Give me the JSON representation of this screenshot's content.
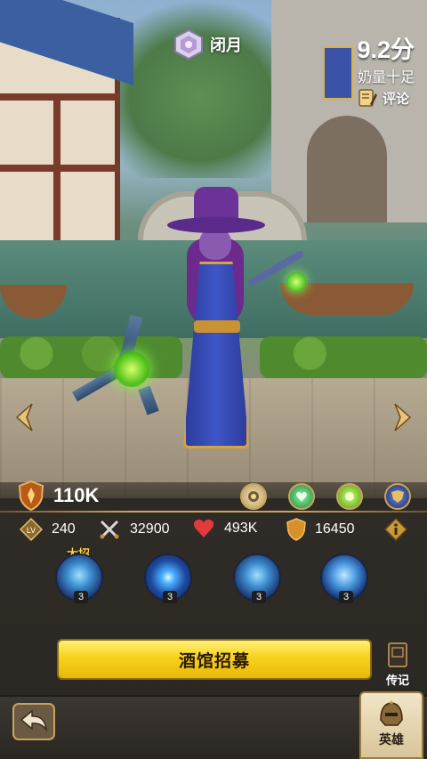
{
  "header": {
    "faction_name": "闭月",
    "faction_icon": "crystal-emblem-icon",
    "rating_score": "9.2分",
    "rating_tag": "奶量十足",
    "comment_label": "评论"
  },
  "hero": {
    "power_value": "110K",
    "stats": {
      "level": "240",
      "attack": "32900",
      "health": "493K",
      "defense": "16450"
    },
    "ultimate_label": "大招",
    "skills": [
      {
        "name": "skill-ultimate",
        "level": "3"
      },
      {
        "name": "skill-eye",
        "level": "3"
      },
      {
        "name": "skill-summon",
        "level": "3"
      },
      {
        "name": "skill-wolf",
        "level": "3"
      }
    ]
  },
  "actions": {
    "recruit_label": "酒馆招募",
    "legend_label": "传记"
  },
  "nav": {
    "hero_tab_label": "英雄"
  },
  "colors": {
    "gold": "#c9a45c",
    "button_yellow": "#f7d21a",
    "panel_dark": "#2b2823"
  }
}
